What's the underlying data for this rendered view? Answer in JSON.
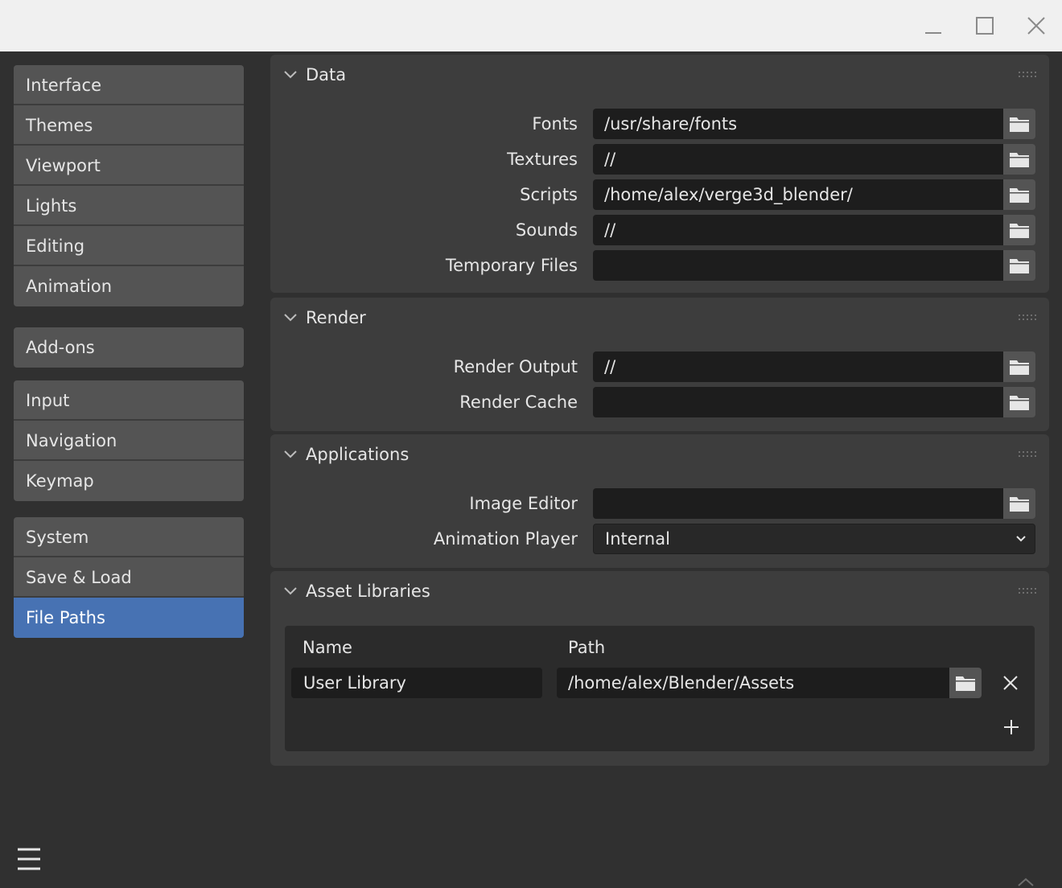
{
  "sidebar": {
    "groups": [
      [
        {
          "label": "Interface"
        },
        {
          "label": "Themes"
        },
        {
          "label": "Viewport"
        },
        {
          "label": "Lights"
        },
        {
          "label": "Editing"
        },
        {
          "label": "Animation"
        }
      ],
      [
        {
          "label": "Add-ons"
        }
      ],
      [
        {
          "label": "Input"
        },
        {
          "label": "Navigation"
        },
        {
          "label": "Keymap"
        }
      ],
      [
        {
          "label": "System"
        },
        {
          "label": "Save & Load"
        },
        {
          "label": "File Paths",
          "active": true
        }
      ]
    ]
  },
  "panels": {
    "data": {
      "title": "Data",
      "rows": [
        {
          "label": "Fonts",
          "value": "/usr/share/fonts"
        },
        {
          "label": "Textures",
          "value": "//"
        },
        {
          "label": "Scripts",
          "value": "/home/alex/verge3d_blender/"
        },
        {
          "label": "Sounds",
          "value": "//"
        },
        {
          "label": "Temporary Files",
          "value": ""
        }
      ]
    },
    "render": {
      "title": "Render",
      "rows": [
        {
          "label": "Render Output",
          "value": "//"
        },
        {
          "label": "Render Cache",
          "value": ""
        }
      ]
    },
    "applications": {
      "title": "Applications",
      "image_editor": {
        "label": "Image Editor",
        "value": ""
      },
      "animation_player": {
        "label": "Animation Player",
        "value": "Internal"
      }
    },
    "asset_libraries": {
      "title": "Asset Libraries",
      "col_name": "Name",
      "col_path": "Path",
      "libraries": [
        {
          "name": "User Library",
          "path": "/home/alex/Blender/Assets"
        }
      ]
    }
  },
  "colors": {
    "accent": "#4772b3",
    "background": "#303030",
    "panel": "#3d3d3d",
    "field": "#1d1d1d",
    "nav_item": "#545454"
  },
  "icons": {
    "folder": "folder-icon",
    "collapse": "chevron-down-icon",
    "remove": "close-icon",
    "add": "plus-icon",
    "menu": "hamburger-menu-icon"
  }
}
